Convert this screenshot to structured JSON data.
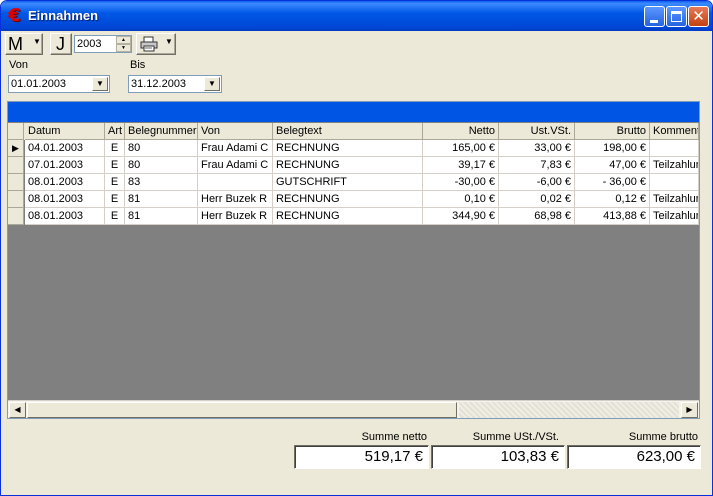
{
  "window": {
    "title": "Einnahmen",
    "app_icon": "euro-icon"
  },
  "toolbar": {
    "month_button": "M",
    "year_button": "J",
    "year_value": "2003",
    "print_icon": "printer-icon"
  },
  "filters": {
    "from_label": "Von",
    "from_value": "01.01.2003",
    "to_label": "Bis",
    "to_value": "31.12.2003"
  },
  "colors": {
    "caption_bar": "#0055e5",
    "grid_empty": "#808080",
    "titlebar": "#0058e6"
  },
  "table": {
    "columns": [
      "Datum",
      "Art",
      "Belegnummer",
      "Von",
      "Belegtext",
      "Netto",
      "Ust.VSt.",
      "Brutto",
      "Komment"
    ],
    "rows": [
      [
        "04.01.2003",
        "E",
        "80",
        "Frau Adami C",
        "RECHNUNG",
        "165,00 €",
        "33,00 €",
        "198,00 €",
        ""
      ],
      [
        "07.01.2003",
        "E",
        "80",
        "Frau Adami C",
        "RECHNUNG",
        "39,17 €",
        "7,83 €",
        "47,00 €",
        "Teilzahlur"
      ],
      [
        "08.01.2003",
        "E",
        "83",
        "",
        "GUTSCHRIFT",
        "-30,00 €",
        "-6,00 €",
        "- 36,00 €",
        ""
      ],
      [
        "08.01.2003",
        "E",
        "81",
        "Herr Buzek R",
        "RECHNUNG",
        "0,10 €",
        "0,02 €",
        "0,12 €",
        "Teilzahlur"
      ],
      [
        "08.01.2003",
        "E",
        "81",
        "Herr Buzek R",
        "RECHNUNG",
        "344,90 €",
        "68,98 €",
        "413,88 €",
        "Teilzahlur"
      ]
    ]
  },
  "totals": {
    "netto_label": "Summe netto",
    "netto_value": "519,17 €",
    "ust_label": "Summe USt./VSt.",
    "ust_value": "103,83 €",
    "brutto_label": "Summe brutto",
    "brutto_value": "623,00 €"
  }
}
